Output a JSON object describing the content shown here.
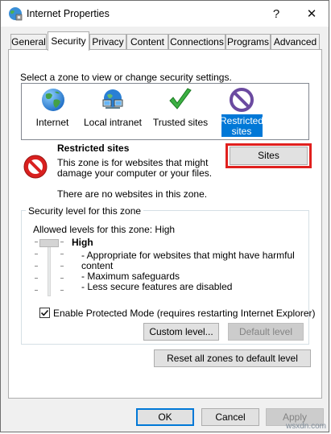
{
  "window": {
    "title": "Internet Properties",
    "help_label": "?",
    "close_label": "✕"
  },
  "tabs": [
    {
      "label": "General"
    },
    {
      "label": "Security",
      "selected": true
    },
    {
      "label": "Privacy"
    },
    {
      "label": "Content"
    },
    {
      "label": "Connections"
    },
    {
      "label": "Programs"
    },
    {
      "label": "Advanced"
    }
  ],
  "zones": {
    "instruction": "Select a zone to view or change security settings.",
    "items": [
      {
        "label": "Internet",
        "icon": "globe-icon"
      },
      {
        "label": "Local intranet",
        "icon": "intranet-icon"
      },
      {
        "label": "Trusted sites",
        "icon": "checkmark-icon"
      },
      {
        "label_line1": "Restricted",
        "label_line2": "sites",
        "icon": "restricted-icon",
        "selected": true
      }
    ]
  },
  "zone_info": {
    "title": "Restricted sites",
    "description_line1": "This zone is for websites that might",
    "description_line2": "damage your computer or your files.",
    "note": "There are no websites in this zone.",
    "sites_button": "Sites",
    "highlight_color": "#e0201e"
  },
  "security_level": {
    "group_title": "Security level for this zone",
    "allowed_label": "Allowed levels for this zone: High",
    "level_name": "High",
    "bullets_line1": "- Appropriate for websites that might have harmful",
    "bullets_line1_cont": "content",
    "bullets_line2": "- Maximum safeguards",
    "bullets_line3": "- Less secure features are disabled",
    "slider_level": "High",
    "protected_mode_label": "Enable Protected Mode (requires restarting Internet Explorer)",
    "protected_mode_checked": true,
    "custom_level_button": "Custom level...",
    "default_level_button": "Default level"
  },
  "reset_button": "Reset all zones to default level",
  "footer": {
    "ok": "OK",
    "cancel": "Cancel",
    "apply": "Apply"
  },
  "watermark": "wsxdn.com",
  "colors": {
    "accent": "#0078d7",
    "selection": "#0078d7",
    "highlight_box": "#e0201e"
  }
}
